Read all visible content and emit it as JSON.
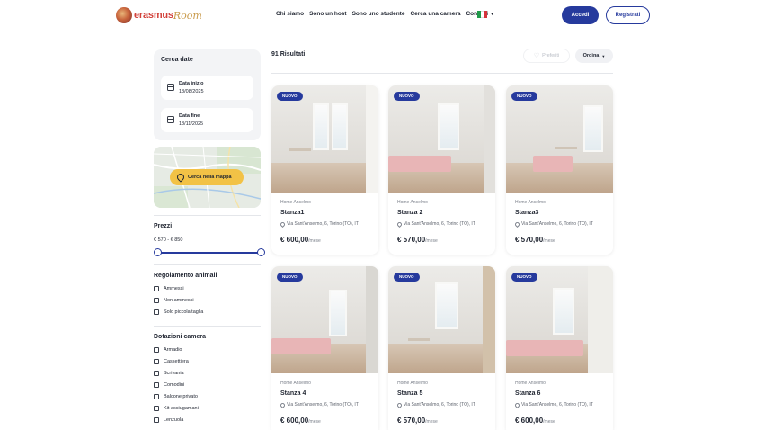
{
  "header": {
    "logo_text": "erasmus",
    "logo_script": "Room",
    "nav": [
      "Chi siamo",
      "Sono un host",
      "Sono uno studente",
      "Cerca una camera",
      "Contatti"
    ],
    "language": "IT",
    "accedi_label": "Accedi",
    "registrati_label": "Registrati"
  },
  "sidebar": {
    "date_title": "Cerca date",
    "start_label": "Data inizio",
    "start_value": "18/08/2025",
    "end_label": "Data fine",
    "end_value": "18/11/2025",
    "map_button": "Cerca nella mappa",
    "prices_title": "Prezzi",
    "price_range": "€ 570 - € 850",
    "price_min": 570,
    "price_max": 850,
    "animals_title": "Regolamento animali",
    "animals": [
      "Ammessi",
      "Non ammessi",
      "Solo piccola taglia"
    ],
    "equipment_title": "Dotazioni camera",
    "equipment": [
      "Armadio",
      "Cassettiera",
      "Scrivania",
      "Comodini",
      "Balcone privato",
      "Kit asciugamani",
      "Lenzuola"
    ]
  },
  "results": {
    "count": "91 Risultati",
    "favorites_label": "Preferiti",
    "sort_label": "Ordina",
    "cards": [
      {
        "badge": "NUOVO",
        "owner": "Home Anselmo",
        "title": "Stanza1",
        "address": "Via Sant'Anselmo, 6, Torino (TO), IT",
        "price": "€ 600,00",
        "unit": "/mese"
      },
      {
        "badge": "NUOVO",
        "owner": "Home Anselmo",
        "title": "Stanza 2",
        "address": "Via Sant'Anselmo, 6, Torino (TO), IT",
        "price": "€ 570,00",
        "unit": "/mese"
      },
      {
        "badge": "NUOVO",
        "owner": "Home Anselmo",
        "title": "Stanza3",
        "address": "Via Sant'Anselmo, 6, Torino (TO), IT",
        "price": "€ 570,00",
        "unit": "/mese"
      },
      {
        "badge": "NUOVO",
        "owner": "Home Anselmo",
        "title": "Stanza 4",
        "address": "Via Sant'Anselmo, 6, Torino (TO), IT",
        "price": "€ 600,00",
        "unit": "/mese"
      },
      {
        "badge": "NUOVO",
        "owner": "Home Anselmo",
        "title": "Stanza 5",
        "address": "Via Sant'Anselmo, 6, Torino (TO), IT",
        "price": "€ 570,00",
        "unit": "/mese"
      },
      {
        "badge": "NUOVO",
        "owner": "Home Anselmo",
        "title": "Stanza 6",
        "address": "Via Sant'Anselmo, 6, Torino (TO), IT",
        "price": "€ 600,00",
        "unit": "/mese"
      }
    ]
  },
  "colors": {
    "primary": "#263a9d",
    "map_button": "#f2c246",
    "brand_red": "#d2413a"
  }
}
